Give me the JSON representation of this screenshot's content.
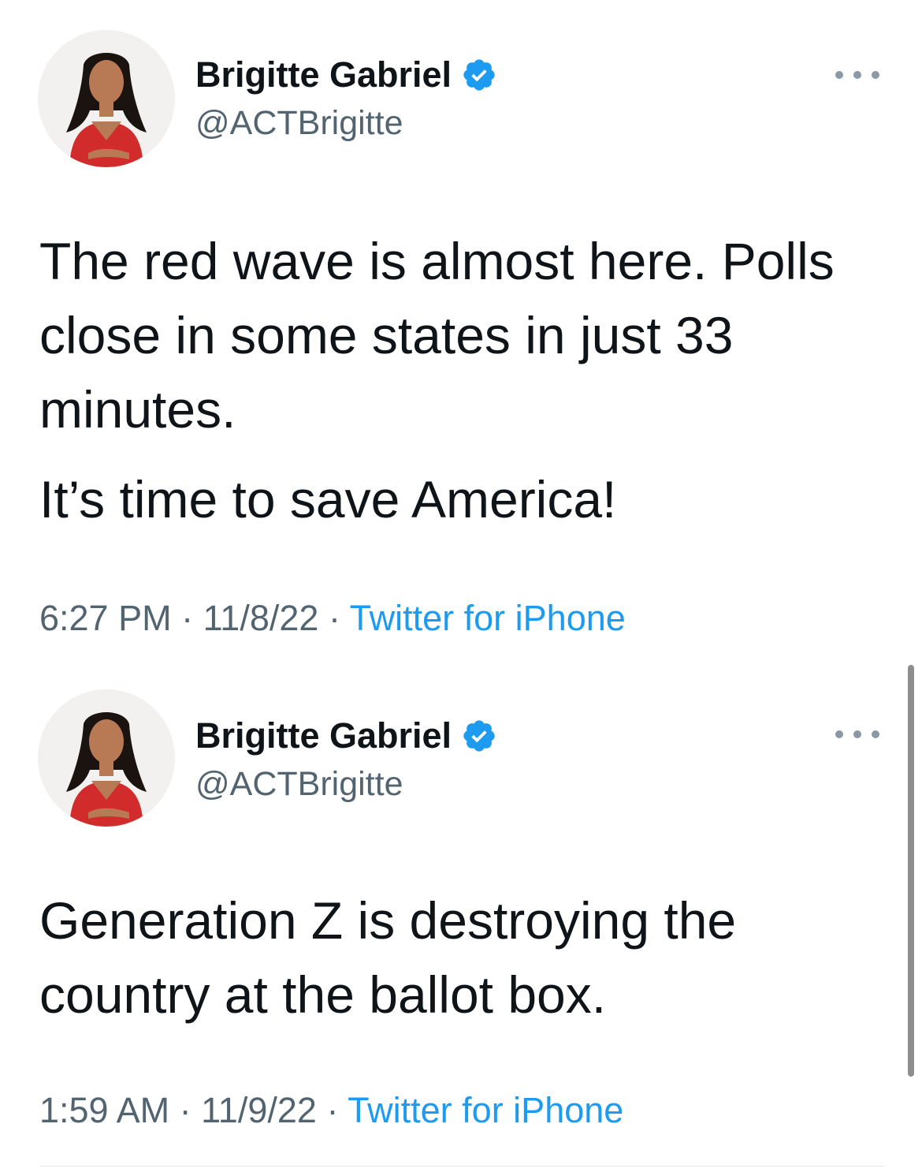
{
  "tweets": [
    {
      "author": {
        "display_name": "Brigitte Gabriel",
        "handle": "@ACTBrigitte",
        "verified": true
      },
      "text_paragraphs": [
        "The red wave is almost here. Polls close in some states in just 33 minutes.",
        "It’s time to save America!"
      ],
      "time": "6:27 PM",
      "date": "11/8/22",
      "separator": "·",
      "source": "Twitter for iPhone"
    },
    {
      "author": {
        "display_name": "Brigitte Gabriel",
        "handle": "@ACTBrigitte",
        "verified": true
      },
      "text_paragraphs": [
        "Generation Z is destroying the country at the ballot box."
      ],
      "time": "1:59 AM",
      "date": "11/9/22",
      "separator": "·",
      "source": "Twitter for iPhone"
    }
  ],
  "icons": {
    "verified": "verified-badge-icon",
    "more": "more-options-icon"
  },
  "colors": {
    "text_primary": "#0f1419",
    "text_secondary": "#536471",
    "link": "#1d9bf0",
    "verified": "#1d9bf0"
  }
}
